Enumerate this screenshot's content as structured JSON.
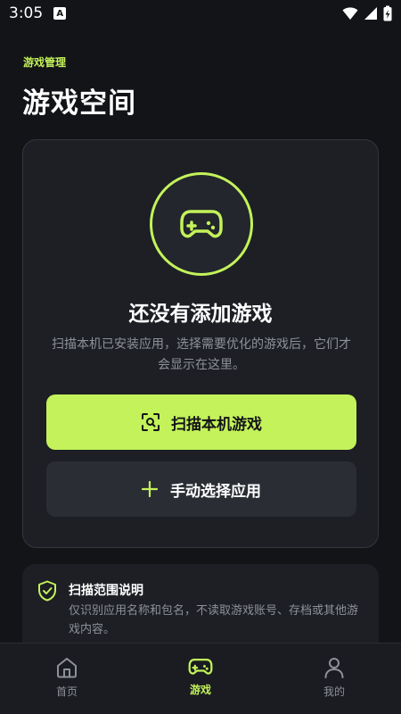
{
  "status_bar": {
    "time": "3:05",
    "notification_badge": "A"
  },
  "header": {
    "eyebrow": "游戏管理",
    "title": "游戏空间"
  },
  "empty_state": {
    "icon": "gamepad-icon",
    "title": "还没有添加游戏",
    "description": "扫描本机已安装应用，选择需要优化的游戏后，它们才会显示在这里。"
  },
  "actions": {
    "scan_label": "扫描本机游戏",
    "manual_label": "手动选择应用"
  },
  "info": {
    "title": "扫描范围说明",
    "text": "仅识别应用名称和包名，不读取游戏账号、存档或其他游戏内容。"
  },
  "nav": {
    "items": [
      {
        "label": "首页",
        "icon": "home-icon",
        "active": false
      },
      {
        "label": "游戏",
        "icon": "gamepad-icon",
        "active": true
      },
      {
        "label": "我的",
        "icon": "person-icon",
        "active": false
      }
    ]
  },
  "colors": {
    "accent": "#c3f25a",
    "background": "#131418",
    "card": "#1d1f25"
  }
}
